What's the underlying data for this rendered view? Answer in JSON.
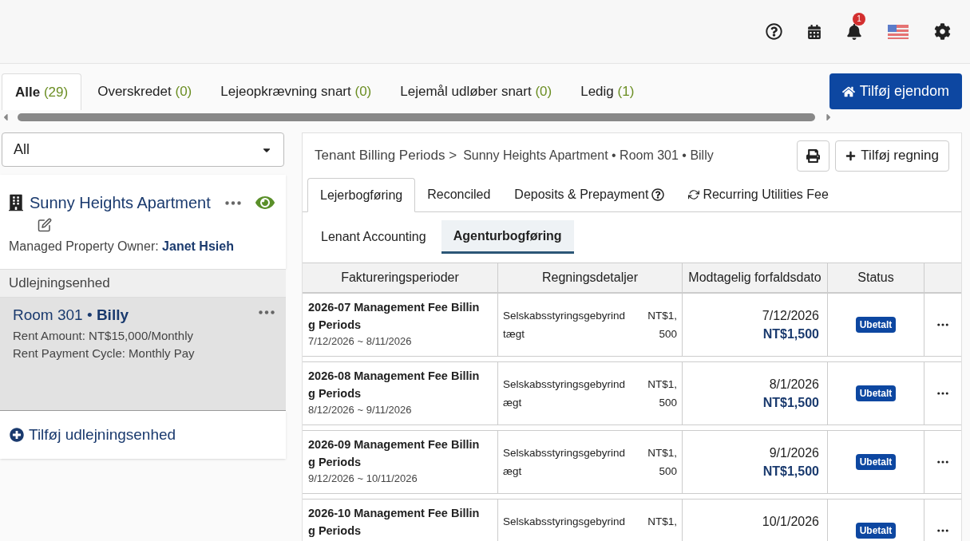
{
  "top_bar": {
    "notification_count": "1"
  },
  "tabs": [
    {
      "label": "Alle",
      "count": "(29)",
      "selected": true
    },
    {
      "label": "Overskredet",
      "count": "(0)",
      "selected": false
    },
    {
      "label": "Lejeopkrævning snart",
      "count": "(0)",
      "selected": false
    },
    {
      "label": "Lejemål udløber snart",
      "count": "(0)",
      "selected": false
    },
    {
      "label": "Ledig",
      "count": "(1)",
      "selected": false
    }
  ],
  "add_property_button": "Tilføj ejendom",
  "filter_select": {
    "value": "All"
  },
  "property": {
    "name": "Sunny Heights Apartment",
    "owner_label": "Managed Property Owner:",
    "owner_name": "Janet Hsieh"
  },
  "units_header": "Udlejningsenhed",
  "units": [
    {
      "room": "Room 301",
      "separator": "•",
      "tenant": "Billy",
      "rent_amount": "Rent Amount: NT$15,000/Monthly",
      "cycle": "Rent Payment Cycle: Monthly Pay",
      "selected": true
    }
  ],
  "add_unit_link": "Tilføj udlejningsenhed",
  "breadcrumb": {
    "root": "Tenant Billing Periods >",
    "path": "Sunny Heights Apartment • Room 301 • Billy"
  },
  "add_bill_button": "Tilføj regning",
  "main_tabs": [
    {
      "label": "Lejerbogføring",
      "selected": true,
      "kind": "plain"
    },
    {
      "label": "Reconciled",
      "selected": false,
      "kind": "plain"
    },
    {
      "label": "Deposits & Prepayment",
      "selected": false,
      "kind": "help"
    },
    {
      "label": "Recurring Utilities Fee",
      "selected": false,
      "kind": "recurring"
    }
  ],
  "sub_tabs": [
    {
      "label": "Lenant Accounting",
      "selected": false
    },
    {
      "label": "Agenturbogføring",
      "selected": true
    }
  ],
  "table": {
    "columns": [
      "Faktureringsperioder",
      "Regningsdetaljer",
      "Modtagelig forfaldsdato",
      "Status"
    ],
    "rows": [
      {
        "title_lines": [
          "2026-07 Management Fee Billin",
          "g Periods"
        ],
        "range": "7/12/2026 ~ 8/11/2026",
        "detail_lines": [
          "Selskabsstyringsgebyrind",
          "tægt"
        ],
        "amount_lines": [
          "NT$1,",
          "500"
        ],
        "due_date": "7/12/2026",
        "due_amount": "NT$1,500",
        "status": "Ubetalt"
      },
      {
        "title_lines": [
          "2026-08 Management Fee Billin",
          "g Periods"
        ],
        "range": "8/12/2026 ~ 9/11/2026",
        "detail_lines": [
          "Selskabsstyringsgebyrind",
          "ægt"
        ],
        "amount_lines": [
          "NT$1,",
          "500"
        ],
        "due_date": "8/1/2026",
        "due_amount": "NT$1,500",
        "status": "Ubetalt"
      },
      {
        "title_lines": [
          "2026-09 Management Fee Billin",
          "g Periods"
        ],
        "range": "9/12/2026 ~ 10/11/2026",
        "detail_lines": [
          "Selskabsstyringsgebyrind",
          "ægt"
        ],
        "amount_lines": [
          "NT$1,",
          "500"
        ],
        "due_date": "9/1/2026",
        "due_amount": "NT$1,500",
        "status": "Ubetalt"
      },
      {
        "title_lines": [
          "2026-10 Management Fee Billin",
          "g Periods"
        ],
        "detail_lines": [
          "Selskabsstyringsgebyrind"
        ],
        "amount_lines": [
          "NT$1,"
        ],
        "due_date": "10/1/2026",
        "status": "Ubetalt"
      }
    ]
  }
}
